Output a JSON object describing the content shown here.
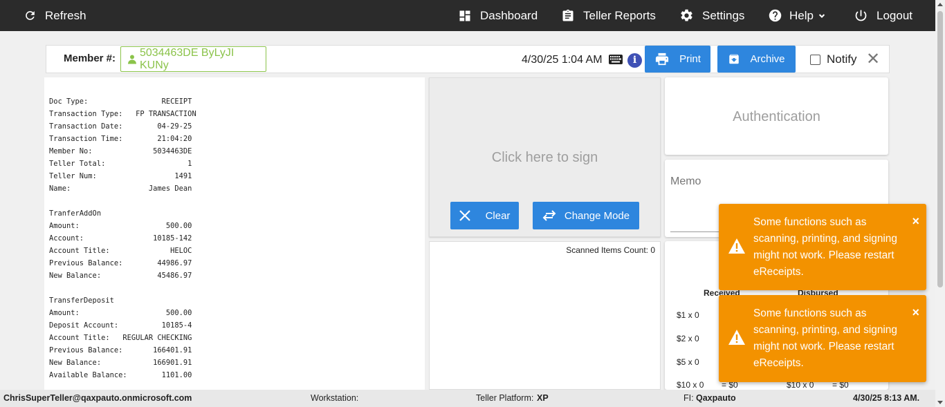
{
  "nav": {
    "refresh": "Refresh",
    "dashboard": "Dashboard",
    "teller_reports": "Teller Reports",
    "settings": "Settings",
    "help": "Help",
    "logout": "Logout"
  },
  "member": {
    "label": "Member #:",
    "value": "5034463DE ByLyJI KUNy",
    "datetime": "4/30/25 1:04 AM",
    "info_glyph": "i"
  },
  "actions": {
    "print": "Print",
    "archive": "Archive",
    "notify": "Notify",
    "close_glyph": "✕"
  },
  "receipt": {
    "lines": [
      "Doc Type:                 RECEIPT",
      "Transaction Type:   FP TRANSACTION",
      "Transaction Date:        04-29-25",
      "Transaction Time:        21:04:20",
      "Member No:              5034463DE",
      "Teller Total:                   1",
      "Teller Num:                  1491",
      "Name:                  James Dean",
      "",
      "TranferAddOn",
      "Amount:                    500.00",
      "Account:                10185-142",
      "Account Title:              HELOC",
      "Previous Balance:        44986.97",
      "New Balance:             45486.97",
      "",
      "TransferDeposit",
      "Amount:                    500.00",
      "Deposit Account:          10185-4",
      "Account Title:   REGULAR CHECKING",
      "Previous Balance:       166401.91",
      "New Balance:            166901.91",
      "Available Balance:        1101.00"
    ]
  },
  "signature": {
    "placeholder": "Click here to sign",
    "clear": "Clear",
    "change_mode": "Change Mode"
  },
  "scan": {
    "count_label": "Scanned Items Count: 0"
  },
  "auth": {
    "label": "Authentication"
  },
  "memo": {
    "label": "Memo"
  },
  "cash": {
    "received": "Received",
    "disbursed": "Disbursed",
    "rows": [
      "$1 x 0",
      "$2 x 0",
      "$5 x 0",
      "$10 x 0"
    ],
    "row_total": "= $0",
    "disbursed_row": "$10 x 0",
    "disbursed_total": "= $0"
  },
  "toasts": [
    {
      "message": "Some functions such as scanning, printing, and signing might not work. Please restart eReceipts.",
      "close": "×"
    },
    {
      "message": "Some functions such as scanning, printing, and signing might not work. Please restart eReceipts.",
      "close": "×"
    }
  ],
  "status": {
    "user": "ChrisSuperTeller@qaxpauto.onmicrosoft.com",
    "workstation_label": "Workstation:",
    "platform_label": "Teller Platform:",
    "platform_value": "XP",
    "fi_label": "FI:",
    "fi_value": "Qaxpauto",
    "datetime": "4/30/25 8:13 AM."
  },
  "colors": {
    "nav_bg": "#2b2b2b",
    "accent_blue": "#2e86de",
    "member_green": "#8bc34a",
    "toast_orange": "#f39200",
    "info_blue": "#3f51b5"
  }
}
